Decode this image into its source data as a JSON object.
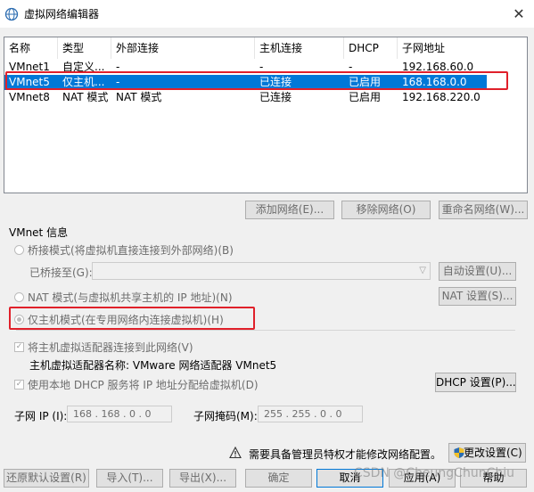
{
  "window": {
    "title": "虚拟网络编辑器",
    "close_glyph": "✕"
  },
  "table": {
    "columns": [
      "名称",
      "类型",
      "外部连接",
      "主机连接",
      "DHCP",
      "子网地址"
    ],
    "rows": [
      {
        "name": "VMnet1",
        "type": "自定义...",
        "external": "-",
        "host": "-",
        "dhcp": "-",
        "subnet": "192.168.60.0"
      },
      {
        "name": "VMnet5",
        "type": "仅主机...",
        "external": "-",
        "host": "已连接",
        "dhcp": "已启用",
        "subnet": "168.168.0.0"
      },
      {
        "name": "VMnet8",
        "type": "NAT 模式",
        "external": "NAT 模式",
        "host": "已连接",
        "dhcp": "已启用",
        "subnet": "192.168.220.0"
      }
    ],
    "selected_row": 1
  },
  "list_buttons": {
    "add": "添加网络(E)...",
    "remove": "移除网络(O)",
    "rename": "重命名网络(W)..."
  },
  "vmnet_info": {
    "label": "VMnet 信息",
    "bridged_radio": "桥接模式(将虚拟机直接连接到外部网络)(B)",
    "bridged_to_label": "已桥接至(G):",
    "auto_settings": "自动设置(U)...",
    "nat_radio": "NAT 模式(与虚拟机共享主机的 IP 地址)(N)",
    "nat_settings": "NAT 设置(S)...",
    "host_only_radio": "仅主机模式(在专用网络内连接虚拟机)(H)",
    "connect_adapter_checkbox": "将主机虚拟适配器连接到此网络(V)",
    "adapter_name_label": "主机虚拟适配器名称: VMware 网络适配器 VMnet5",
    "dhcp_checkbox": "使用本地 DHCP 服务将 IP 地址分配给虚拟机(D)",
    "dhcp_settings": "DHCP 设置(P)...",
    "subnet_ip_label": "子网 IP (I):",
    "subnet_ip_value": "168 . 168 .  0  .  0",
    "subnet_mask_label": "子网掩码(M):",
    "subnet_mask_value": "255 . 255 .  0  .  0"
  },
  "footer": {
    "admin_notice": "需要具备管理员特权才能修改网络配置。",
    "change_settings": "更改设置(C)",
    "restore_defaults": "还原默认设置(R)",
    "import": "导入(T)...",
    "export": "导出(X)...",
    "ok": "确定",
    "cancel": "取消",
    "apply": "应用(A)",
    "help": "帮助"
  },
  "watermark": "CSDN @CheungChunChiu",
  "colors": {
    "selection": "#0078d7",
    "highlight": "#e0202a",
    "dialog_bg": "#f0f0f0"
  },
  "icons": {
    "app": "network-editor-icon",
    "warning": "warning-icon",
    "shield": "uac-shield-icon"
  }
}
